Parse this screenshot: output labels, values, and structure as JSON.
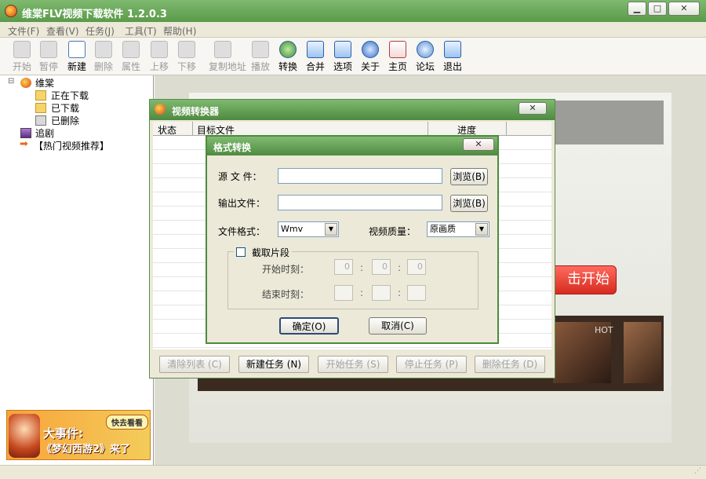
{
  "app": {
    "title": "维棠FLV视频下载软件 1.2.0.3"
  },
  "menu": [
    "文件(F)",
    "查看(V)",
    "任务(J)",
    "工具(T)",
    "帮助(H)"
  ],
  "toolbar": {
    "items": [
      {
        "label": "开始",
        "enabled": false
      },
      {
        "label": "暂停",
        "enabled": false
      },
      {
        "label": "新建",
        "enabled": true
      },
      {
        "label": "删除",
        "enabled": false
      },
      {
        "label": "属性",
        "enabled": false
      },
      {
        "label": "上移",
        "enabled": false
      },
      {
        "label": "下移",
        "enabled": false
      },
      {
        "label": "复制地址",
        "enabled": false
      },
      {
        "label": "播放",
        "enabled": false
      },
      {
        "label": "转换",
        "enabled": true
      },
      {
        "label": "合并",
        "enabled": true
      },
      {
        "label": "选项",
        "enabled": true
      },
      {
        "label": "关于",
        "enabled": true
      },
      {
        "label": "主页",
        "enabled": true
      },
      {
        "label": "论坛",
        "enabled": true
      },
      {
        "label": "退出",
        "enabled": true
      }
    ]
  },
  "tree": {
    "root": "维棠",
    "children": [
      "正在下载",
      "已下载",
      "已删除"
    ],
    "extra": [
      "追剧",
      "【热门视频推荐】"
    ]
  },
  "banner": {
    "headline": "大事件:",
    "subline": "《梦幻西游2》来了",
    "cta": "快去看看"
  },
  "converter": {
    "title": "视频转换器",
    "columns": [
      "状态",
      "目标文件",
      "进度"
    ],
    "buttons": [
      {
        "label": "清除列表 (C)",
        "enabled": false
      },
      {
        "label": "新建任务 (N)",
        "enabled": true
      },
      {
        "label": "开始任务 (S)",
        "enabled": false
      },
      {
        "label": "停止任务 (P)",
        "enabled": false
      },
      {
        "label": "删除任务 (D)",
        "enabled": false
      }
    ]
  },
  "format_dialog": {
    "title": "格式转换",
    "source_label": "源 文 件：",
    "output_label": "输出文件：",
    "browse_source": "浏览(B)",
    "browse_output": "浏览(B)",
    "format_label": "文件格式：",
    "format_value": "Wmv",
    "quality_label": "视频质量：",
    "quality_value": "原画质",
    "clip_label": "截取片段",
    "start_label": "开始时刻：",
    "end_label": "结束时刻：",
    "start_values": [
      "0",
      "0",
      "0"
    ],
    "ok_label": "确定(O)",
    "cancel_label": "取消(C)"
  },
  "background": {
    "start_banner_text": "击开始",
    "thumb_label": "HOT"
  },
  "colors": {
    "title_green": "#5a9a4a",
    "accent_red": "#e8352b",
    "dialog_bg": "#ece9d8"
  }
}
